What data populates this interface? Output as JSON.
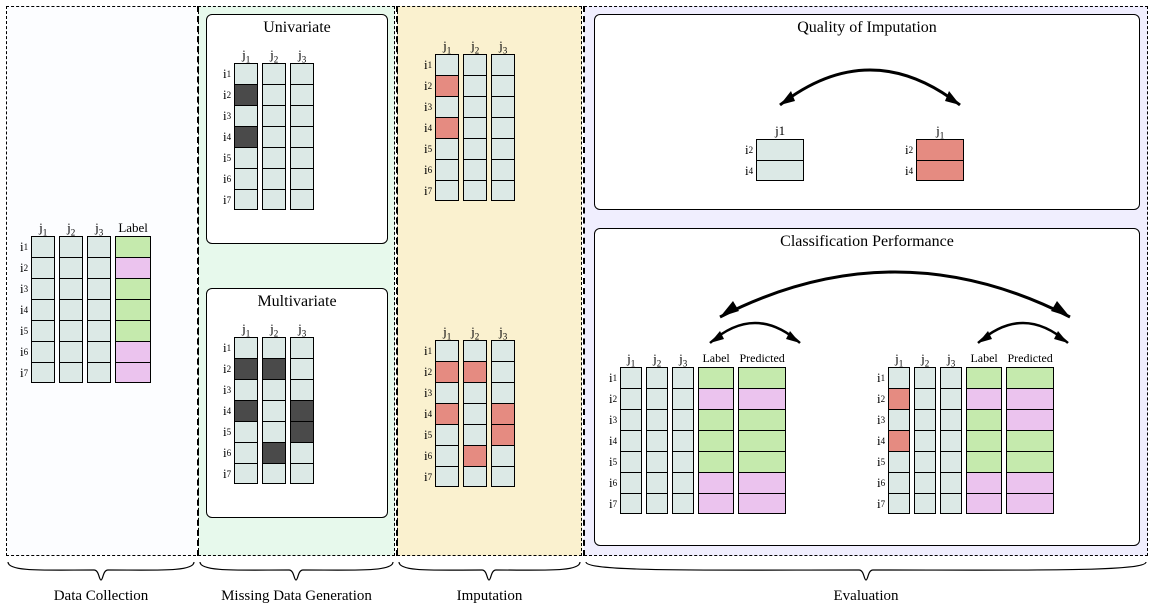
{
  "rows": [
    "i1",
    "i2",
    "i3",
    "i4",
    "i5",
    "i6",
    "i7"
  ],
  "cols3": [
    "j1",
    "j2",
    "j3"
  ],
  "label_col": "Label",
  "predicted_col": "Predicted",
  "stage2": {
    "panel_univ": "Univariate",
    "panel_multi": "Multivariate"
  },
  "stage4": {
    "panel_qoi": "Quality of Imputation",
    "panel_cp": "Classification Performance",
    "qoi_col": "j1",
    "qoi_rows": [
      "i2",
      "i4"
    ]
  },
  "braces": {
    "b1": "Data Collection",
    "b2": "Missing Data Generation",
    "b3": "Imputation",
    "b4": "Evaluation"
  },
  "label_colors": [
    "g",
    "p",
    "g",
    "g",
    "g",
    "p",
    "p"
  ],
  "predicted_left": [
    "g",
    "p",
    "g",
    "g",
    "g",
    "p",
    "p"
  ],
  "predicted_right": [
    "g",
    "p",
    "p",
    "g",
    "g",
    "p",
    "p"
  ]
}
